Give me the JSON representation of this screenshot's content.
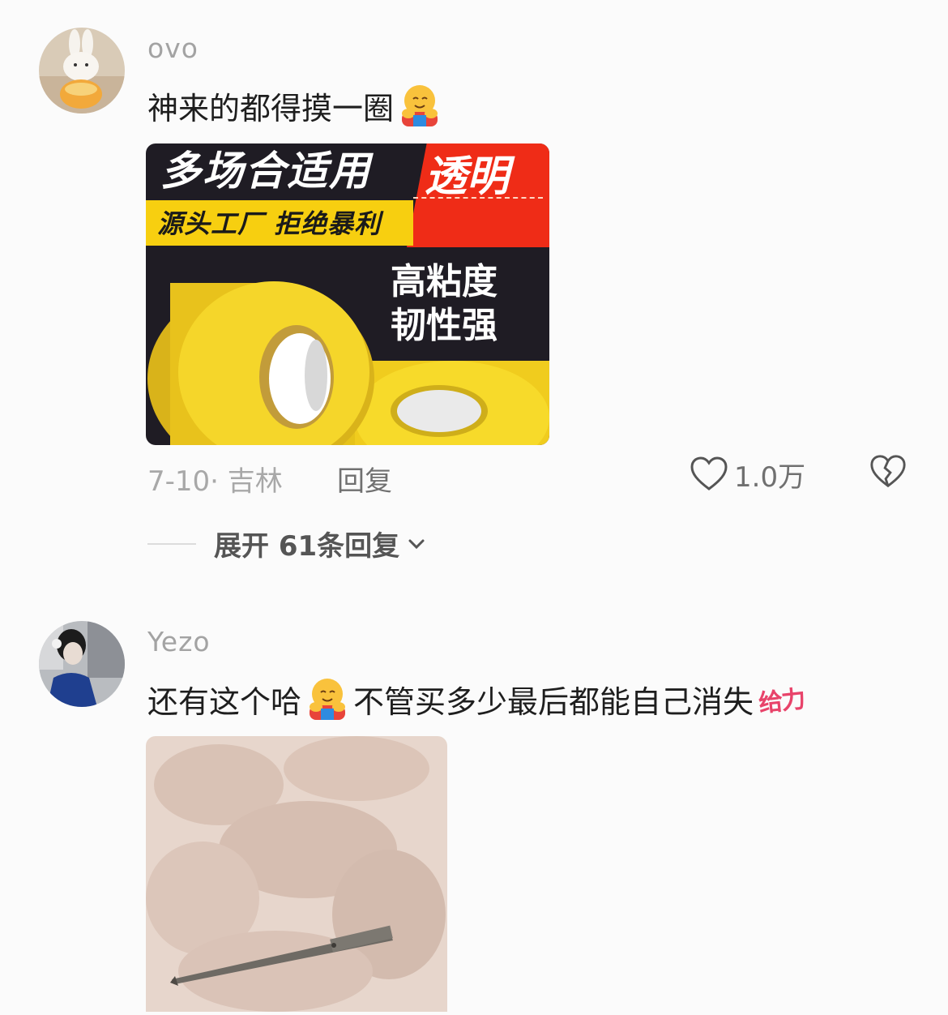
{
  "comments": [
    {
      "username": "ovo",
      "text": "神来的都得摸一圈",
      "text_emoji": "hug-face",
      "image": {
        "kind": "tape-ad",
        "title": "多场合适用",
        "badge": "透明",
        "banner": "源头工厂 拒绝暴利",
        "claim_line1": "高粘度",
        "claim_line2": "韧性强"
      },
      "date_location": "7-10· 吉林",
      "reply_label": "回复",
      "likes": "1.0万",
      "expand_label": "展开 61条回复"
    },
    {
      "username": "Yezo",
      "text_part1": "还有这个哈",
      "text_emoji": "hug-face",
      "text_part2": "不管买多少最后都能自己消失",
      "sticker": "给力",
      "image": {
        "kind": "hair-clip-photo"
      }
    }
  ],
  "colors": {
    "background": "#fbfbfb",
    "username": "#a3a3a3",
    "meta": "#a8a8a8",
    "sticker": "#e8436a"
  }
}
